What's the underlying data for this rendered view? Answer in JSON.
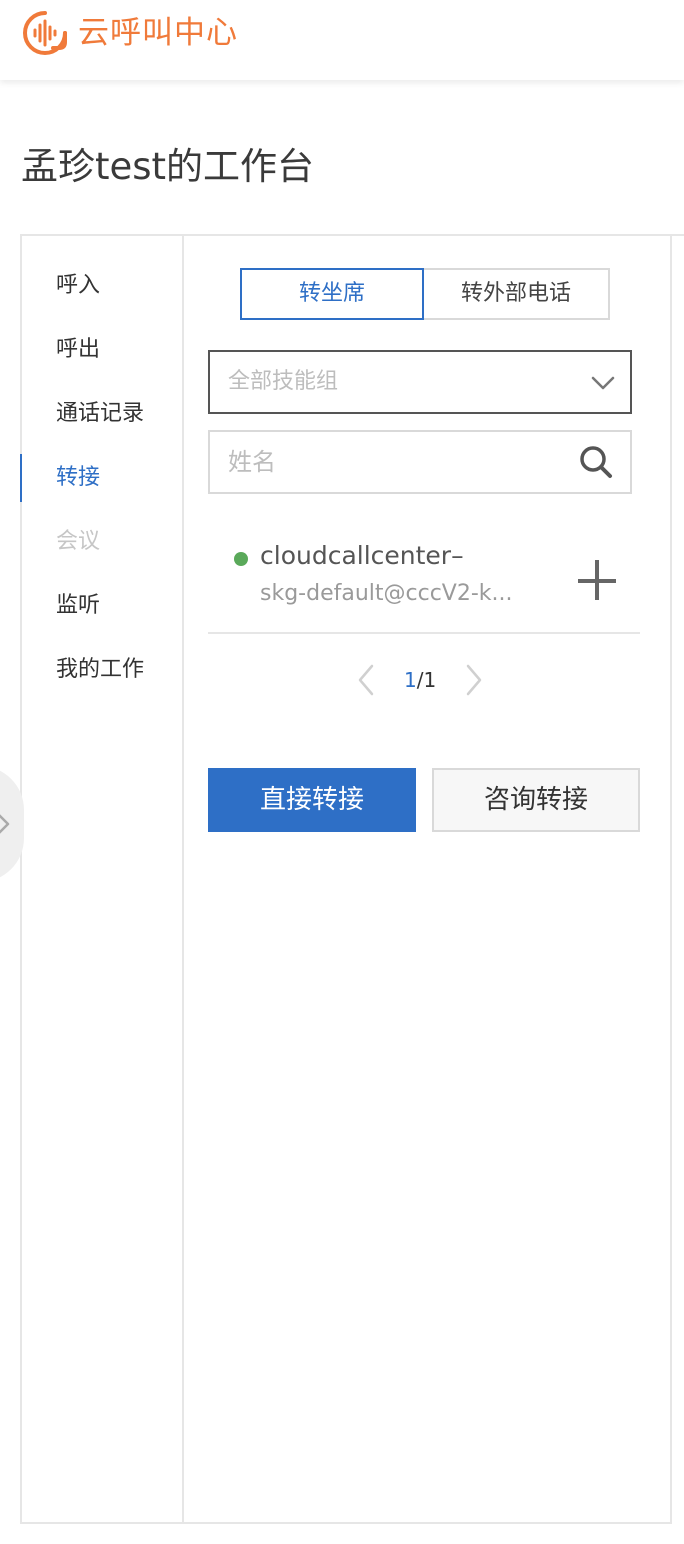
{
  "app": {
    "name": "云呼叫中心",
    "brand_color": "#f07a3a",
    "accent_color": "#2e6fc6"
  },
  "page": {
    "title": "孟珍test的工作台"
  },
  "sidebar": {
    "items": [
      {
        "label": "呼入",
        "state": "normal"
      },
      {
        "label": "呼出",
        "state": "normal"
      },
      {
        "label": "通话记录",
        "state": "normal"
      },
      {
        "label": "转接",
        "state": "active"
      },
      {
        "label": "会议",
        "state": "disabled"
      },
      {
        "label": "监听",
        "state": "normal"
      },
      {
        "label": "我的工作",
        "state": "normal"
      }
    ]
  },
  "transfer": {
    "tabs": [
      {
        "label": "转坐席",
        "selected": true
      },
      {
        "label": "转外部电话",
        "selected": false
      }
    ],
    "skill_group_select": {
      "value": "全部技能组",
      "icon": "chevron-down-icon"
    },
    "search": {
      "placeholder": "姓名",
      "value": "",
      "icon": "search-icon"
    },
    "agents": [
      {
        "name": "cloudcallcenter–",
        "sub": "skg-default@cccV2-k...",
        "status": "online",
        "status_color": "#5aa95a"
      }
    ],
    "pagination": {
      "current": "1",
      "total": "/1"
    },
    "buttons": {
      "direct": "直接转接",
      "consult": "咨询转接"
    }
  }
}
